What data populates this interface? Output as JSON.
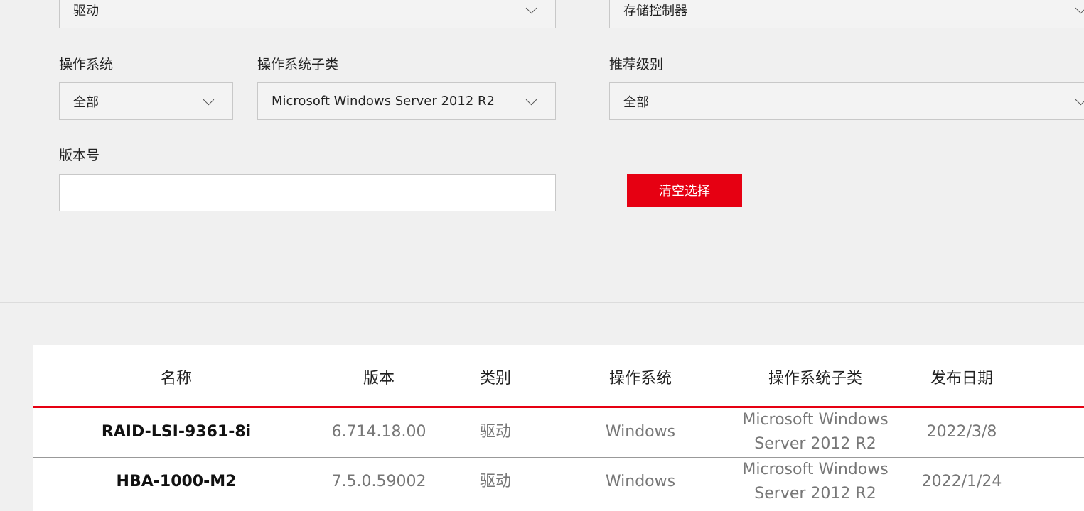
{
  "filters": {
    "type_value": "驱动",
    "category_value": "存储控制器",
    "os_label": "操作系统",
    "os_value": "全部",
    "os_sub_label": "操作系统子类",
    "os_sub_value": "Microsoft Windows Server 2012 R2",
    "level_label": "推荐级别",
    "level_value": "全部",
    "version_label": "版本号",
    "version_value": "",
    "clear_button": "清空选择"
  },
  "table": {
    "headers": [
      "名称",
      "版本",
      "类别",
      "操作系统",
      "操作系统子类",
      "发布日期"
    ],
    "rows": [
      {
        "name": "RAID-LSI-9361-8i",
        "version": "6.714.18.00",
        "category": "驱动",
        "os": "Windows",
        "os_sub_line1": "Microsoft Windows",
        "os_sub_line2": "Server 2012 R2",
        "date": "2022/3/8"
      },
      {
        "name": "HBA-1000-M2",
        "version": "7.5.0.59002",
        "category": "驱动",
        "os": "Windows",
        "os_sub_line1": "Microsoft Windows",
        "os_sub_line2": "Server 2012 R2",
        "date": "2022/1/24"
      }
    ]
  },
  "colors": {
    "accent": "#e60012",
    "background": "#f0f0f0"
  }
}
